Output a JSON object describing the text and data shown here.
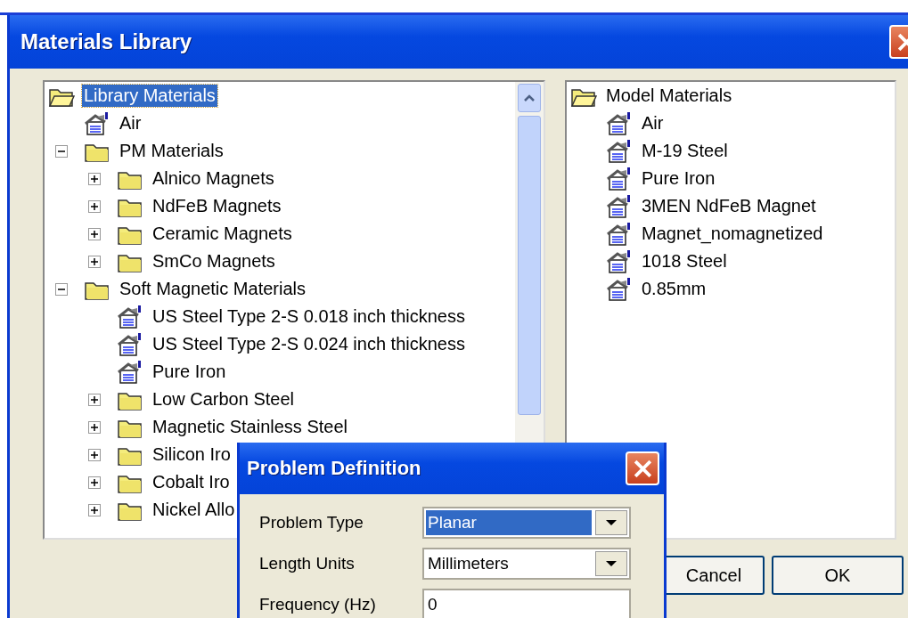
{
  "window": {
    "title": "Materials Library"
  },
  "library_tree": {
    "label": "Library Materials",
    "kind": "folder",
    "selected": true,
    "expanded": true,
    "children": [
      {
        "label": "Air",
        "kind": "material",
        "selected": false
      },
      {
        "label": "PM Materials",
        "kind": "folder",
        "selected": false,
        "expanded": true,
        "children": [
          {
            "label": "Alnico Magnets",
            "kind": "folder",
            "selected": false,
            "expanded": false
          },
          {
            "label": "NdFeB Magnets",
            "kind": "folder",
            "selected": false,
            "expanded": false
          },
          {
            "label": "Ceramic Magnets",
            "kind": "folder",
            "selected": false,
            "expanded": false
          },
          {
            "label": "SmCo Magnets",
            "kind": "folder",
            "selected": false,
            "expanded": false
          }
        ]
      },
      {
        "label": "Soft Magnetic Materials",
        "kind": "folder",
        "selected": false,
        "expanded": true,
        "children": [
          {
            "label": "US Steel Type 2-S 0.018 inch thickness",
            "kind": "material",
            "selected": false
          },
          {
            "label": "US Steel Type 2-S 0.024 inch thickness",
            "kind": "material",
            "selected": false
          },
          {
            "label": "Pure Iron",
            "kind": "material",
            "selected": false
          },
          {
            "label": "Low Carbon Steel",
            "kind": "folder",
            "selected": false,
            "expanded": false
          },
          {
            "label": "Magnetic Stainless Steel",
            "kind": "folder",
            "selected": false,
            "expanded": false
          },
          {
            "label": "Silicon Iro",
            "kind": "folder",
            "selected": false,
            "expanded": false
          },
          {
            "label": "Cobalt Iro",
            "kind": "folder",
            "selected": false,
            "expanded": false
          },
          {
            "label": "Nickel Allo",
            "kind": "folder",
            "selected": false,
            "expanded": false
          }
        ]
      }
    ]
  },
  "model_tree": {
    "label": "Model Materials",
    "kind": "folder",
    "selected": false,
    "expanded": true,
    "children": [
      {
        "label": "Air",
        "kind": "material",
        "selected": false
      },
      {
        "label": "M-19 Steel",
        "kind": "material",
        "selected": false
      },
      {
        "label": "Pure Iron",
        "kind": "material",
        "selected": false
      },
      {
        "label": "3MEN NdFeB Magnet",
        "kind": "material",
        "selected": false
      },
      {
        "label": "Magnet_nomagnetized",
        "kind": "material",
        "selected": false
      },
      {
        "label": "1018 Steel",
        "kind": "material",
        "selected": false
      },
      {
        "label": "0.85mm",
        "kind": "material",
        "selected": false
      }
    ]
  },
  "buttons": [
    "Cancel",
    "OK"
  ],
  "problem_definition": {
    "title": "Problem Definition",
    "fields": [
      {
        "label": "Problem Type",
        "kind": "dropdown",
        "value": "Planar",
        "highlighted": true
      },
      {
        "label": "Length Units",
        "kind": "dropdown",
        "value": "Millimeters",
        "highlighted": false
      },
      {
        "label": "Frequency (Hz)",
        "kind": "text",
        "value": "0",
        "highlighted": false
      }
    ]
  }
}
